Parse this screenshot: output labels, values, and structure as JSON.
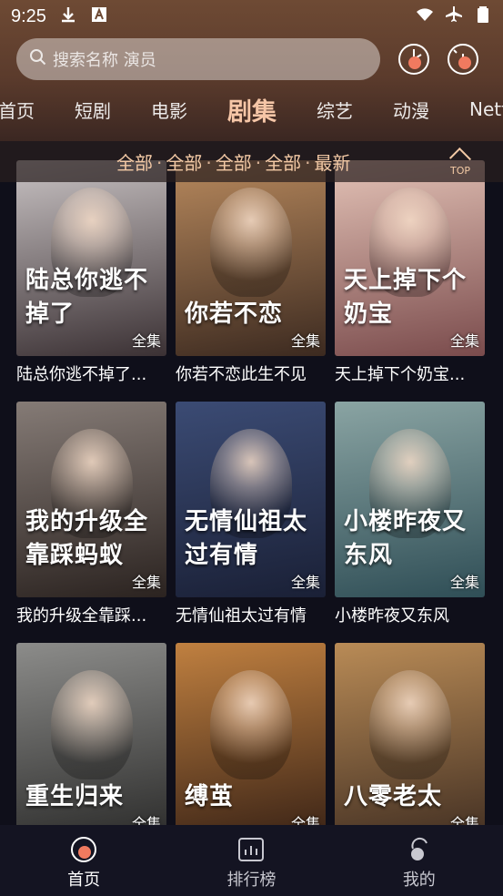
{
  "status": {
    "time": "9:25"
  },
  "search": {
    "placeholder": "搜索名称 演员"
  },
  "tabs": [
    {
      "label": "首页",
      "active": false
    },
    {
      "label": "短剧",
      "active": false
    },
    {
      "label": "电影",
      "active": false
    },
    {
      "label": "剧集",
      "active": true
    },
    {
      "label": "综艺",
      "active": false
    },
    {
      "label": "动漫",
      "active": false
    },
    {
      "label": "Netf",
      "active": false
    }
  ],
  "filters": [
    "全部",
    "全部",
    "全部",
    "全部",
    "最新"
  ],
  "top_button": "TOP",
  "badge_label": "全集",
  "cards": [
    {
      "title": "陆总你逃不掉了...",
      "poster_text": "陆总你逃不掉了",
      "palette": [
        "#c9c3c4",
        "#3b3134"
      ]
    },
    {
      "title": "你若不恋此生不见",
      "poster_text": "你若不恋",
      "palette": [
        "#b8895d",
        "#3c2a20"
      ]
    },
    {
      "title": "天上掉下个奶宝...",
      "poster_text": "天上掉下个奶宝",
      "palette": [
        "#e4c3b7",
        "#7a4b4c"
      ]
    },
    {
      "title": "我的升级全靠踩...",
      "poster_text": "我的升级全靠踩蚂蚁",
      "palette": [
        "#857b76",
        "#2b2320"
      ]
    },
    {
      "title": "无情仙祖太过有情",
      "poster_text": "无情仙祖太过有情",
      "palette": [
        "#3b4b74",
        "#1a2036"
      ]
    },
    {
      "title": "小楼昨夜又东风",
      "poster_text": "小楼昨夜又东风",
      "palette": [
        "#8aa4a3",
        "#2f4e56"
      ]
    },
    {
      "title": "",
      "poster_text": "重生归来",
      "palette": [
        "#8c8c8a",
        "#2c2c2b"
      ]
    },
    {
      "title": "",
      "poster_text": "缚茧",
      "palette": [
        "#c08040",
        "#3a2316"
      ]
    },
    {
      "title": "",
      "poster_text": "八零老太",
      "palette": [
        "#b98b56",
        "#433023"
      ]
    }
  ],
  "bottom_nav": [
    {
      "label": "首页",
      "icon": "home-icon",
      "active": true
    },
    {
      "label": "排行榜",
      "icon": "chart-icon",
      "active": false
    },
    {
      "label": "我的",
      "icon": "profile-icon",
      "active": false
    }
  ]
}
